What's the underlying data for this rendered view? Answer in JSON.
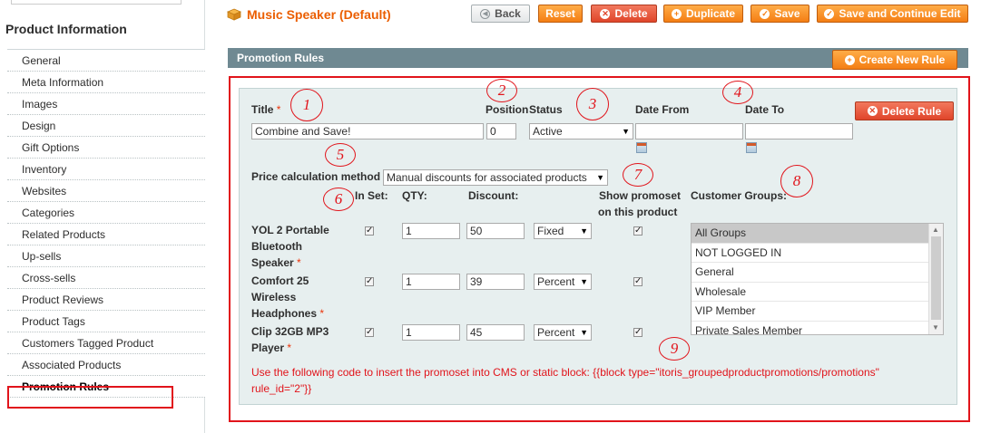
{
  "sidebar": {
    "heading": "Product Information",
    "items": [
      {
        "label": "General"
      },
      {
        "label": "Meta Information"
      },
      {
        "label": "Images"
      },
      {
        "label": "Design"
      },
      {
        "label": "Gift Options"
      },
      {
        "label": "Inventory"
      },
      {
        "label": "Websites"
      },
      {
        "label": "Categories"
      },
      {
        "label": "Related Products"
      },
      {
        "label": "Up-sells"
      },
      {
        "label": "Cross-sells"
      },
      {
        "label": "Product Reviews"
      },
      {
        "label": "Product Tags"
      },
      {
        "label": "Customers Tagged Product"
      },
      {
        "label": "Associated Products"
      },
      {
        "label": "Promotion Rules"
      }
    ],
    "active_item": "Promotion Rules"
  },
  "header": {
    "title": "Music Speaker (Default)",
    "buttons": {
      "back": "Back",
      "reset": "Reset",
      "delete": "Delete",
      "duplicate": "Duplicate",
      "save": "Save",
      "save_continue": "Save and Continue Edit"
    }
  },
  "section": {
    "title": "Promotion Rules",
    "create_button": "Create New Rule"
  },
  "rule": {
    "title_label": "Title",
    "required_mark": "*",
    "title_value": "Combine and Save!",
    "position_label": "Position",
    "position_value": "0",
    "status_label": "Status",
    "status_value": "Active",
    "date_from_label": "Date From",
    "date_from_value": "",
    "date_to_label": "Date To",
    "date_to_value": "",
    "delete_button": "Delete Rule",
    "price_calc_label": "Price calculation method",
    "price_calc_value": "Manual discounts for associated products",
    "columns": {
      "in_set": "In Set:",
      "qty": "QTY:",
      "discount": "Discount:",
      "show_promoset_1": "Show promoset",
      "show_promoset_2": "on this product",
      "customer_groups": "Customer Groups:"
    },
    "products": [
      {
        "name_lines": [
          "YOL 2 Portable",
          "Bluetooth",
          "Speaker"
        ],
        "in_set": true,
        "qty": "1",
        "discount": "50",
        "discount_type": "Fixed",
        "show": true
      },
      {
        "name_lines": [
          "Comfort 25",
          "Wireless",
          "Headphones"
        ],
        "in_set": true,
        "qty": "1",
        "discount": "39",
        "discount_type": "Percent",
        "show": true
      },
      {
        "name_lines": [
          "Clip 32GB MP3",
          "Player"
        ],
        "in_set": true,
        "qty": "1",
        "discount": "45",
        "discount_type": "Percent",
        "show": true
      }
    ],
    "customer_groups": [
      {
        "label": "All Groups",
        "selected": true
      },
      {
        "label": "NOT LOGGED IN",
        "selected": false
      },
      {
        "label": "General",
        "selected": false
      },
      {
        "label": "Wholesale",
        "selected": false
      },
      {
        "label": "VIP Member",
        "selected": false
      },
      {
        "label": "Private Sales Member",
        "selected": false
      }
    ],
    "note_line1": "Use the following code to insert the promoset into CMS or static block: {{block type=\"itoris_groupedproductpromotions/promotions\"",
    "note_line2": "rule_id=\"2\"}}"
  },
  "annotations": [
    "1",
    "2",
    "3",
    "4",
    "5",
    "6",
    "7",
    "8",
    "9"
  ],
  "colors": {
    "accent_orange": "#f47e14",
    "title_orange": "#eb5e00",
    "highlight_red": "#e1141b",
    "section_bar": "#6f8992",
    "panel_bg": "#e7efef"
  }
}
